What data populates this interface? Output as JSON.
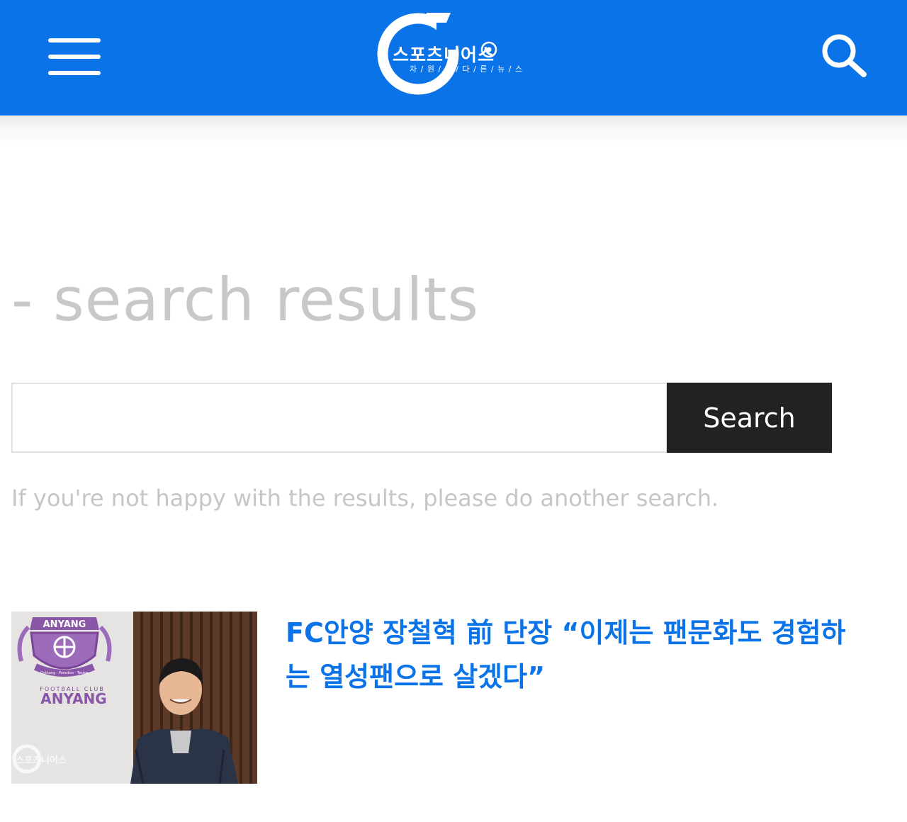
{
  "header": {
    "menu_icon": "hamburger-icon",
    "logo_text": "스포츠니어스",
    "logo_subtitle": "차 / 원 / 이 / 다 / 른 / 뉴 / 스",
    "search_icon": "search-icon",
    "background_color": "#0a73e8"
  },
  "page": {
    "title": "- search results"
  },
  "search": {
    "input_value": "",
    "input_placeholder": "",
    "button_label": "Search"
  },
  "hint": "If you're not happy with the results, please do another search.",
  "results": [
    {
      "title": "FC안양 장철혁 前 단장 “이제는 팬문화도 경험하는 열성팬으로 살겠다”",
      "title_color": "#0a73e8",
      "thumbnail": {
        "crest_top_text": "ANYANG",
        "crest_ribbon_text": "Osthang · Paradiso · Teston",
        "club_label_small": "FOOTBALL CLUB",
        "club_label_large": "ANYANG",
        "watermark_text": "스포츠니어스"
      }
    }
  ]
}
